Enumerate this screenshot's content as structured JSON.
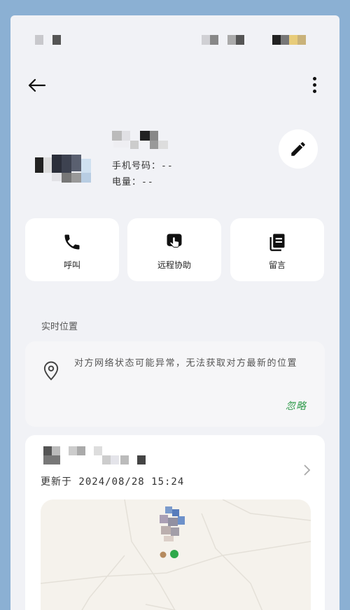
{
  "nav": {
    "back_icon": "arrow-left-icon",
    "more_icon": "more-vertical-icon"
  },
  "profile": {
    "phone_label": "手机号码：",
    "phone_value": "--",
    "battery_label": "电量：",
    "battery_value": "--",
    "edit_icon": "pencil-icon"
  },
  "actions": [
    {
      "label": "呼叫",
      "icon": "phone-icon"
    },
    {
      "label": "远程协助",
      "icon": "remote-assist-icon"
    },
    {
      "label": "留言",
      "icon": "message-icon"
    }
  ],
  "location": {
    "section_title": "实时位置",
    "message": "对方网络状态可能异常，无法获取对方最新的位置",
    "ignore_label": "忽略",
    "pin_icon": "location-pin-icon"
  },
  "map": {
    "updated": "更新于 2024/08/28 15:24",
    "chevron_icon": "chevron-right-icon"
  },
  "colors": {
    "accent_green": "#2e9a4a",
    "background": "#f1f2f6",
    "frame": "#8bb0d3"
  }
}
